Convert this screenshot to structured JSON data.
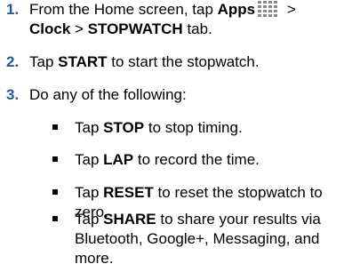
{
  "steps": [
    {
      "number": "1.",
      "line1_prefix": "From the Home screen, tap ",
      "apps_label": "Apps",
      "apps_icon": "apps-grid-icon",
      "line1_suffix": " >",
      "clock_label": "Clock",
      "separator": " > ",
      "stopwatch_label": "STOPWATCH",
      "line2_suffix": " tab."
    },
    {
      "number": "2.",
      "prefix": "Tap ",
      "keyword": "START",
      "suffix": " to start the stopwatch."
    },
    {
      "number": "3.",
      "text": "Do any of the following:"
    }
  ],
  "substeps": [
    {
      "prefix": "Tap ",
      "keyword": "STOP",
      "suffix": " to stop timing."
    },
    {
      "prefix": "Tap ",
      "keyword": "LAP",
      "suffix": " to record the time."
    },
    {
      "prefix": "Tap ",
      "keyword": "RESET",
      "suffix": " to reset the stopwatch to zero."
    },
    {
      "prefix": "Tap ",
      "keyword": "SHARE",
      "suffix": " to share your results via Bluetooth, Google+, Messaging, and more."
    }
  ],
  "colors": {
    "step_number": "#1f5c99",
    "text": "#000000",
    "icon": "#8a8a8a"
  }
}
